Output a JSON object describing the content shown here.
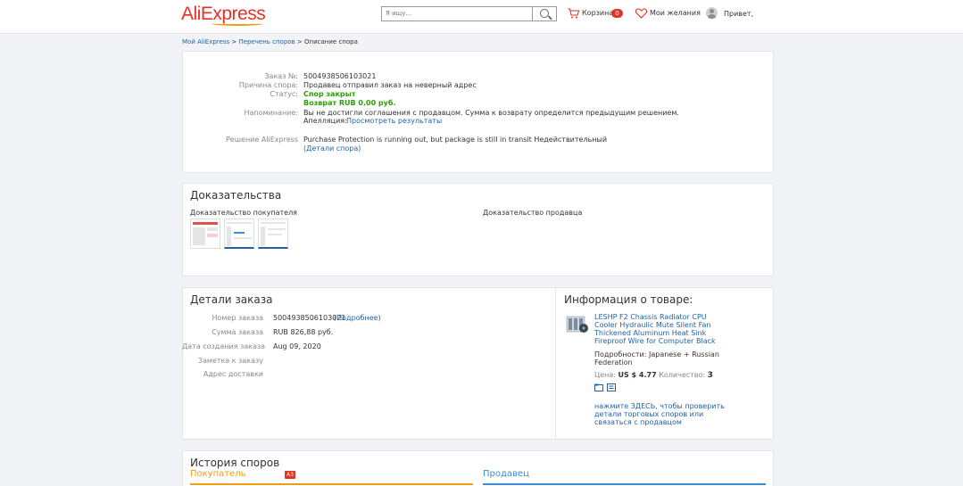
{
  "header": {
    "logo_text": "AliExpress",
    "search_placeholder": "Я ищу...",
    "cart_label": "Корзина",
    "cart_count": "0",
    "wishlist_label": "Мои желания",
    "greeting": "Привет,"
  },
  "breadcrumb": {
    "home": "Мой AliExpress",
    "sep1": " > ",
    "list": "Перечень споров",
    "sep2": " > ",
    "current": "Описание спора"
  },
  "dispute": {
    "order_label": "Заказ №:",
    "order_value": "5004938506103021",
    "reason_label": "Причина спора:",
    "reason_value": "Продавец отправил заказ на неверный адрес",
    "status_label": "Статус:",
    "status_value": "Спор закрыт",
    "refund_value": "Возврат RUB 0,00 руб.",
    "reminder_label": "Напоминание:",
    "reminder_value": "Вы не достигли соглашения с продавцом. Сумма к возврату определится предыдущим решением.",
    "appeal_label": "Апелляция:",
    "appeal_link": "Просмотреть результаты",
    "decision_label": "Решение AliExpress",
    "decision_value": "Purchase Protection is running out, but package is still in transit  Недействительный",
    "details_link": "(Детали спора)"
  },
  "evidence": {
    "title": "Доказательства",
    "buyer_label": "Доказательство покупателя",
    "seller_label": "Доказательство продавца"
  },
  "order_details": {
    "title": "Детали заказа",
    "number_label": "Номер заказа",
    "number_value": "5004938506103021",
    "more_link": "(Подробнее)",
    "sum_label": "Сумма заказа",
    "sum_value": "RUB 826,88 руб.",
    "date_label": "Дата создания заказа",
    "date_value": "Aug 09, 2020",
    "note_label": "Заметка к заказу",
    "address_label": "Адрес доставки"
  },
  "product": {
    "title": "Информация о товаре:",
    "name": "LESHP F2 Chassis Radiator CPU Cooler Hydraulic Mute Silent Fan Thickened Aluminum Heat Sink Fireproof Wire for Computer Black",
    "details_label": "Подробности:",
    "details_value": "Japanese + Russian Federation",
    "price_label": "Цена:",
    "price_value": "US $ 4.77",
    "qty_label": "Количество:",
    "qty_value": "3",
    "contact_link": "нажмите ЗДЕСЬ, чтобы проверить детали торговых споров или связаться с продавцом"
  },
  "history": {
    "title": "История споров",
    "buyer_tab": "Покупатель",
    "buyer_badge": "A3",
    "seller_tab": "Продавец"
  },
  "colors": {
    "brand": "#e43225",
    "link": "#1f62a8",
    "status_green": "#2f9c0a",
    "buyer_accent": "#f39c12",
    "seller_accent": "#3a8ddc"
  }
}
